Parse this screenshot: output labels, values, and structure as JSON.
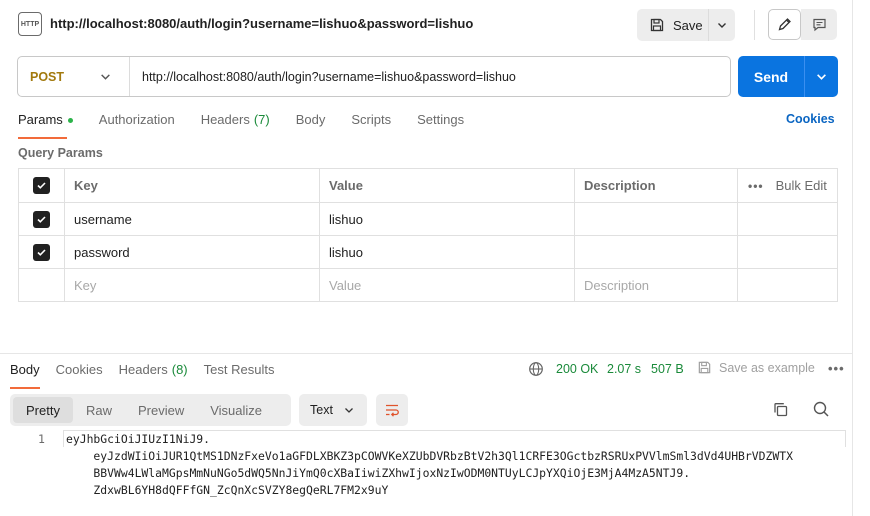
{
  "header": {
    "http_badge": "HTTP",
    "title": "http://localhost:8080/auth/login?username=lishuo&password=lishuo",
    "save_label": "Save"
  },
  "request": {
    "method": "POST",
    "url": "http://localhost:8080/auth/login?username=lishuo&password=lishuo",
    "send_label": "Send"
  },
  "tabs": {
    "params": "Params",
    "authorization": "Authorization",
    "headers": "Headers",
    "headers_count": "(7)",
    "body": "Body",
    "scripts": "Scripts",
    "settings": "Settings",
    "cookies": "Cookies"
  },
  "query_params": {
    "title": "Query Params",
    "columns": {
      "key": "Key",
      "value": "Value",
      "description": "Description",
      "bulk_edit": "Bulk Edit"
    },
    "rows": [
      {
        "key": "username",
        "value": "lishuo",
        "description": ""
      },
      {
        "key": "password",
        "value": "lishuo",
        "description": ""
      }
    ],
    "placeholders": {
      "key": "Key",
      "value": "Value",
      "description": "Description"
    }
  },
  "response": {
    "tabs": {
      "body": "Body",
      "cookies": "Cookies",
      "headers": "Headers",
      "headers_count": "(8)",
      "test_results": "Test Results"
    },
    "status": "200 OK",
    "time": "2.07 s",
    "size": "507 B",
    "save_example": "Save as example",
    "views": [
      "Pretty",
      "Raw",
      "Preview",
      "Visualize"
    ],
    "format": "Text",
    "line_number": "1",
    "body_lines": [
      "eyJhbGciOiJIUzI1NiJ9.",
      "    eyJzdWIiOiJUR1QtMS1DNzFxeVo1aGFDLXBKZ3pCOWVKeXZUbDVRbzBtV2h3Ql1CRFE3OGctbzRSRUxPVVlmSml3dVd4UHBrVDZWTX",
      "    BBVWw4LWlaMGpsMmNuNGo5dWQ5NnJiYmQ0cXBaIiwiZXhwIjoxNzIwODM0NTUyLCJpYXQiOjE3MjA4MzA5NTJ9.",
      "    ZdxwBL6YH8dQFFfGN_ZcQnXcSVZY8egQeRL7FM2x9uY"
    ]
  }
}
